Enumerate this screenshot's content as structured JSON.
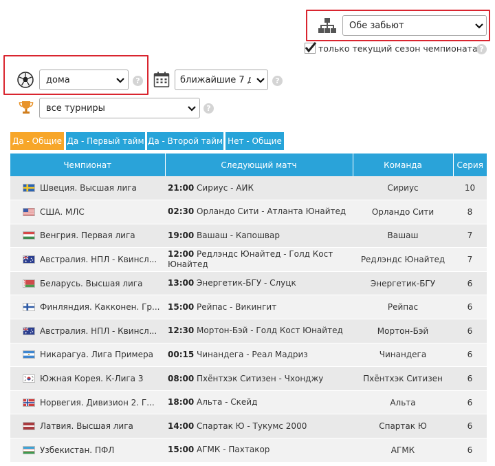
{
  "filters": {
    "bet_type": {
      "selected": "Обе забьют"
    },
    "current_season": {
      "label": "только текущий сезон чемпионата",
      "checked": true
    },
    "location": {
      "selected": "дома"
    },
    "period": {
      "selected": "ближайшие 7 д"
    },
    "tournament": {
      "selected": "все турниры"
    },
    "help_glyph": "?"
  },
  "tabs": [
    {
      "label": "Да - Общие",
      "active": true
    },
    {
      "label": "Да - Первый тайм",
      "active": false
    },
    {
      "label": "Да - Второй тайм",
      "active": false
    },
    {
      "label": "Нет - Общие",
      "active": false
    }
  ],
  "table": {
    "headers": [
      "Чемпионат",
      "Следующий матч",
      "Команда",
      "Серия"
    ],
    "rows": [
      {
        "flag": "sweden",
        "championship": "Швеция. Высшая лига",
        "time": "21:00",
        "match": "Сириус - АИК",
        "team": "Сириус",
        "series": "10"
      },
      {
        "flag": "usa",
        "championship": "США. МЛС",
        "time": "02:30",
        "match": "Орландо Сити - Атланта Юнайтед",
        "team": "Орландо Сити",
        "series": "8"
      },
      {
        "flag": "hungary",
        "championship": "Венгрия. Первая лига",
        "time": "19:00",
        "match": "Вашаш - Капошвар",
        "team": "Вашаш",
        "series": "7"
      },
      {
        "flag": "australia",
        "championship": "Австралия. НПЛ - Квинсл...",
        "time": "12:00",
        "match": "Редлэндс Юнайтед - Голд Кост Юнайтед",
        "team": "Редлэндс Юнайтед",
        "series": "7"
      },
      {
        "flag": "belarus",
        "championship": "Беларусь. Высшая лига",
        "time": "13:00",
        "match": "Энергетик-БГУ - Слуцк",
        "team": "Энергетик-БГУ",
        "series": "6"
      },
      {
        "flag": "finland",
        "championship": "Финляндия. Какконен. Гр...",
        "time": "15:00",
        "match": "Рейпас - Викингит",
        "team": "Рейпас",
        "series": "6"
      },
      {
        "flag": "australia",
        "championship": "Австралия. НПЛ - Квинсл...",
        "time": "12:30",
        "match": "Мортон-Бэй - Голд Кост Юнайтед",
        "team": "Мортон-Бэй",
        "series": "6"
      },
      {
        "flag": "nicaragua",
        "championship": "Никарагуа. Лига Примера",
        "time": "00:15",
        "match": "Чинандега - Реал Мадриз",
        "team": "Чинандега",
        "series": "6"
      },
      {
        "flag": "korea",
        "championship": "Южная Корея. К-Лига 3",
        "time": "08:00",
        "match": "Пхёнтхэк Ситизен - Чхонджу",
        "team": "Пхёнтхэк Ситизен",
        "series": "6"
      },
      {
        "flag": "norway",
        "championship": "Норвегия. Дивизион 2. Г...",
        "time": "18:00",
        "match": "Альта - Скейд",
        "team": "Альта",
        "series": "6"
      },
      {
        "flag": "latvia",
        "championship": "Латвия. Высшая лига",
        "time": "14:00",
        "match": "Спартак Ю - Тукумс 2000",
        "team": "Спартак Ю",
        "series": "6"
      },
      {
        "flag": "uzbekistan",
        "championship": "Узбекистан. ПФЛ",
        "time": "15:00",
        "match": "АГМК - Пахтакор",
        "team": "АГМК",
        "series": "6"
      }
    ]
  },
  "colors": {
    "highlight_box": "#d9252f",
    "tab_active": "#f7a629",
    "tab_inactive": "#27a4d9",
    "table_header": "#2aa3d9"
  }
}
